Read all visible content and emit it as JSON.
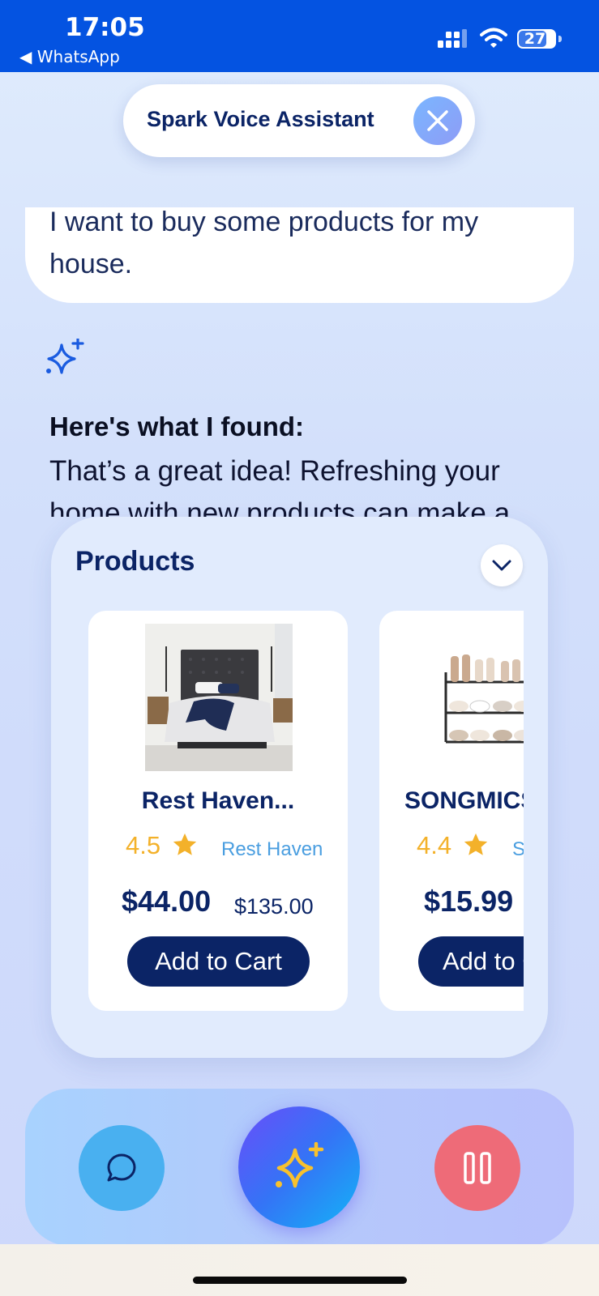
{
  "status_bar": {
    "time": "17:05",
    "back_app": "◀ WhatsApp",
    "battery": "27"
  },
  "header": {
    "title": "Spark Voice Assistant",
    "close_icon": "close-icon"
  },
  "conversation": {
    "user_message": "I want to buy some products for my house.",
    "response_heading": "Here's what I found:",
    "response_text": "That’s a great idea! Refreshing your home with new products can make a"
  },
  "products": {
    "title": "Products",
    "items": [
      {
        "name": "Rest Haven...",
        "rating": "4.5",
        "brand": "Rest Haven",
        "price": "$44.00",
        "old_price": "$135.00",
        "button": "Add to Cart"
      },
      {
        "name": "SONGMICS",
        "rating": "4.4",
        "brand": "SONGMICS",
        "price": "$15.99",
        "button": "Add to Cart"
      }
    ]
  },
  "bottom_bar": {
    "chat_icon": "chat-bubble-icon",
    "assistant_icon": "sparkle-icon",
    "pause_icon": "pause-icon"
  },
  "colors": {
    "brand_navy": "#0b2466",
    "status_blue": "#0453e1",
    "star": "#f3b12a",
    "pause": "#ee6b78",
    "chat": "#49b0f0"
  }
}
